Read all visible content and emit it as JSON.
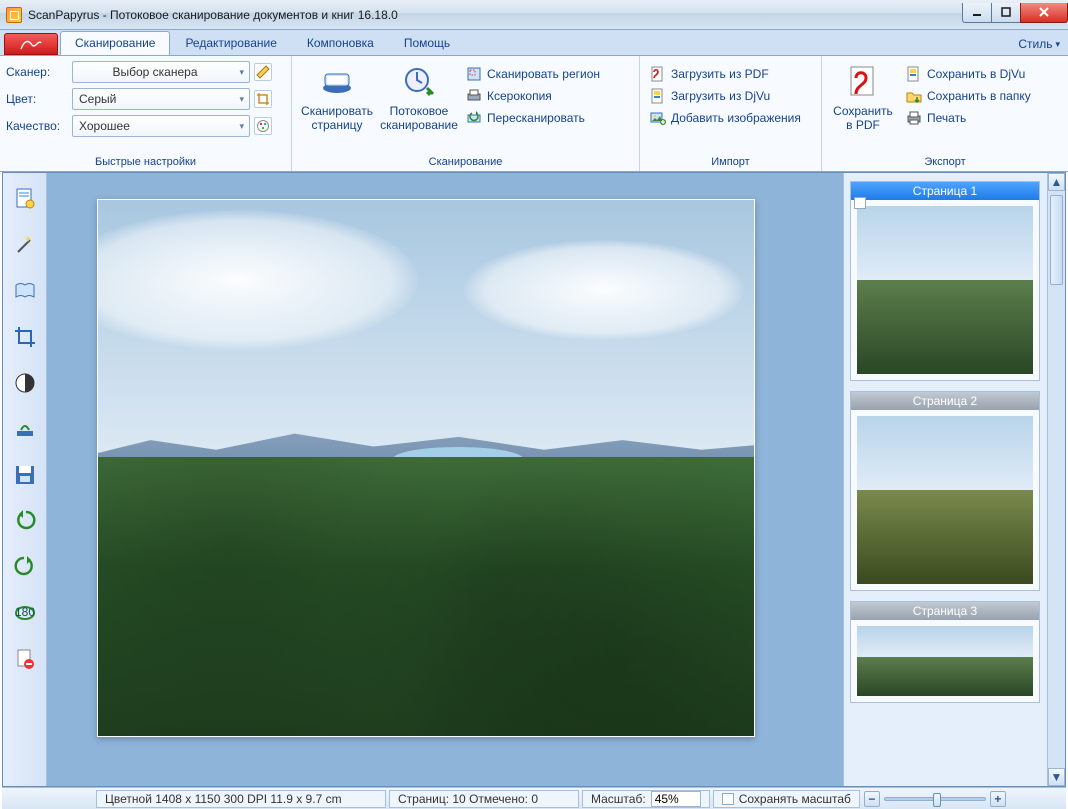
{
  "window": {
    "title": "ScanPapyrus - Потоковое сканирование документов и книг 16.18.0"
  },
  "tabs": {
    "items": [
      "Сканирование",
      "Редактирование",
      "Компоновка",
      "Помощь"
    ],
    "active": 0,
    "style": "Стиль"
  },
  "ribbon": {
    "quick": {
      "scanner_label": "Сканер:",
      "scanner_value": "Выбор сканера",
      "color_label": "Цвет:",
      "color_value": "Серый",
      "quality_label": "Качество:",
      "quality_value": "Хорошее",
      "group": "Быстрые настройки"
    },
    "scan": {
      "scan_page": "Сканировать страницу",
      "stream_scan": "Потоковое сканирование",
      "scan_region": "Сканировать регион",
      "xerox": "Ксерокопия",
      "rescan": "Пересканировать",
      "group": "Сканирование"
    },
    "import": {
      "load_pdf": "Загрузить из PDF",
      "load_djvu": "Загрузить из DjVu",
      "add_images": "Добавить изображения",
      "group": "Импорт"
    },
    "export": {
      "save_pdf": "Сохранить в PDF",
      "save_djvu": "Сохранить в DjVu",
      "save_folder": "Сохранить в папку",
      "print": "Печать",
      "group": "Экспорт"
    }
  },
  "pages": {
    "label_prefix": "Страница",
    "items": [
      {
        "label": "Страница 1",
        "selected": true
      },
      {
        "label": "Страница 2",
        "selected": false
      },
      {
        "label": "Страница 3",
        "selected": false
      }
    ]
  },
  "status": {
    "info": "Цветной  1408 x 1150  300 DPI  11.9 x 9.7 cm",
    "pages": "Страниц: 10 Отмечено: 0",
    "zoom_label": "Масштаб:",
    "zoom_value": "45%",
    "keep_zoom": "Сохранять масштаб"
  }
}
